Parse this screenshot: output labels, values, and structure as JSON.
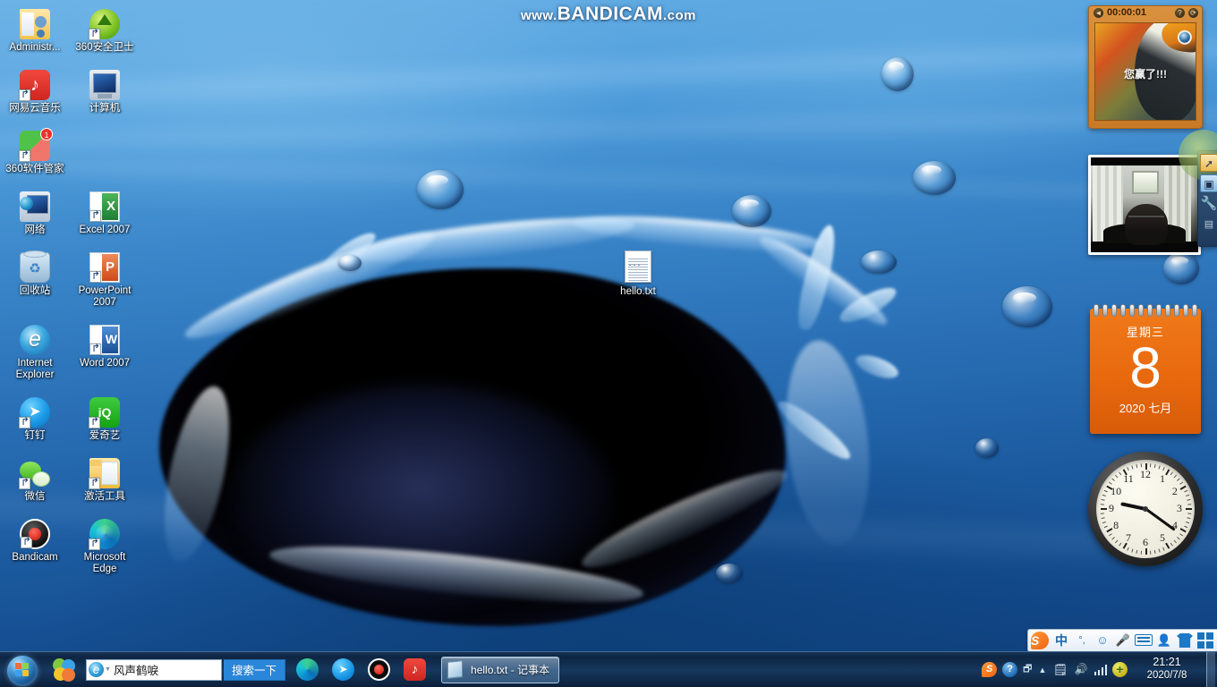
{
  "watermark": {
    "prefix": "www.",
    "brand": "BANDICAM",
    "suffix": ".com"
  },
  "desktop": {
    "icons": [
      {
        "label": "Administr...",
        "art": "ic-folderuser",
        "shortcut": false,
        "badge": ""
      },
      {
        "label": "360安全卫士",
        "art": "ic-360",
        "shortcut": true,
        "badge": ""
      },
      {
        "label": "网易云音乐",
        "art": "ic-netease",
        "shortcut": true,
        "badge": ""
      },
      {
        "label": "计算机",
        "art": "ic-computer",
        "shortcut": false,
        "badge": ""
      },
      {
        "label": "360软件管家",
        "art": "ic-360soft",
        "shortcut": true,
        "badge": "1"
      },
      {
        "label": "",
        "art": "ic-spacer",
        "shortcut": false,
        "badge": ""
      },
      {
        "label": "网络",
        "art": "ic-network",
        "shortcut": false,
        "badge": ""
      },
      {
        "label": "Excel 2007",
        "art": "ic-excel",
        "shortcut": true,
        "badge": ""
      },
      {
        "label": "",
        "art": "ic-spacer",
        "shortcut": false,
        "badge": ""
      },
      {
        "label": "回收站",
        "art": "ic-recycle",
        "shortcut": false,
        "badge": ""
      },
      {
        "label": "PowerPoint 2007",
        "art": "ic-ppt",
        "shortcut": true,
        "badge": ""
      },
      {
        "label": "",
        "art": "ic-spacer",
        "shortcut": false,
        "badge": ""
      },
      {
        "label": "Internet Explorer",
        "art": "ic-ie",
        "shortcut": false,
        "badge": ""
      },
      {
        "label": "Word 2007",
        "art": "ic-word",
        "shortcut": true,
        "badge": ""
      },
      {
        "label": "",
        "art": "ic-spacer",
        "shortcut": false,
        "badge": ""
      },
      {
        "label": "钉钉",
        "art": "ic-dingtalk",
        "shortcut": true,
        "badge": ""
      },
      {
        "label": "爱奇艺",
        "art": "ic-iqiyi",
        "shortcut": true,
        "badge": ""
      },
      {
        "label": "",
        "art": "ic-spacer",
        "shortcut": false,
        "badge": ""
      },
      {
        "label": "微信",
        "art": "ic-wechat",
        "shortcut": true,
        "badge": ""
      },
      {
        "label": "激活工具",
        "art": "ic-folder",
        "shortcut": true,
        "badge": ""
      },
      {
        "label": "",
        "art": "ic-spacer",
        "shortcut": false,
        "badge": ""
      },
      {
        "label": "Bandicam",
        "art": "ic-bandicam",
        "shortcut": true,
        "badge": ""
      },
      {
        "label": "Microsoft Edge",
        "art": "ic-edge",
        "shortcut": true,
        "badge": ""
      }
    ],
    "file": {
      "label": "hello.txt"
    }
  },
  "gadgets": {
    "puzzle": {
      "timer": "00:00:01",
      "win_message": "您赢了!!!",
      "back_icon": "back-arrow-icon",
      "help_icon": "help-icon",
      "refresh_icon": "refresh-icon"
    },
    "webcam": {
      "name": "webcam-preview"
    },
    "calendar": {
      "day_of_week": "星期三",
      "day": "8",
      "month_year": "2020 七月"
    },
    "clock": {
      "numbers": [
        "12",
        "1",
        "2",
        "3",
        "4",
        "5",
        "6",
        "7",
        "8",
        "9",
        "10",
        "11"
      ],
      "reading": "9:21"
    }
  },
  "bandicam_panel": {
    "buttons": [
      {
        "icon": "cursor-record-icon"
      },
      {
        "icon": "screen-capture-icon"
      },
      {
        "icon": "wrench-settings-icon"
      },
      {
        "icon": "list-icon"
      }
    ]
  },
  "taskbar": {
    "start": {
      "name": "start-button"
    },
    "pinned": [
      {
        "name": "taskbar-360-safe",
        "art": "tb-360"
      }
    ],
    "search": {
      "value": "风声鹤唳",
      "placeholder": "",
      "button_label": "搜索一下"
    },
    "quicklaunch": [
      {
        "name": "taskbar-edge",
        "art": "tb-edge"
      },
      {
        "name": "taskbar-dingtalk",
        "art": "tb-ding"
      },
      {
        "name": "taskbar-bandicam",
        "art": "tb-band"
      },
      {
        "name": "taskbar-netease-music",
        "art": "tb-ne"
      }
    ],
    "window": {
      "label": "hello.txt - 记事本"
    },
    "ime": {
      "items": [
        "sogou-logo-icon",
        "中",
        "punctuation-icon",
        "emoji-icon",
        "microphone-icon",
        "keyboard-icon",
        "user-icon",
        "skin-icon",
        "toolbox-icon"
      ],
      "mode": "中",
      "punct": "°,"
    },
    "tray": {
      "icons": [
        "sogou-icon",
        "help-icon",
        "overlap-windows-icon",
        "show-hidden-icons-chevron",
        "notes-icon",
        "volume-icon",
        "network-signal-icon",
        "action-center-shield-icon"
      ],
      "time": "21:21",
      "date": "2020/7/8"
    }
  }
}
